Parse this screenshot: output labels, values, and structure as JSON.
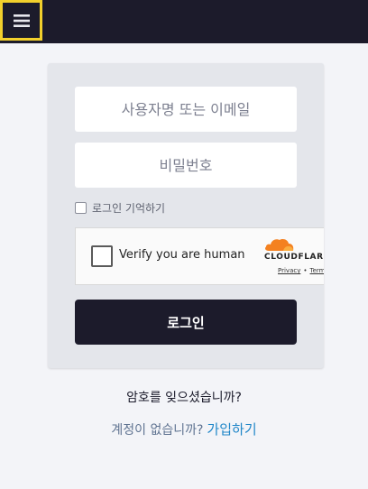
{
  "header": {
    "menu_icon": "hamburger-menu-icon",
    "background_color": "#1c1b2b",
    "focus_outline_color": "#f2d02c"
  },
  "login_form": {
    "username": {
      "placeholder": "사용자명 또는 이메일",
      "value": ""
    },
    "password": {
      "placeholder": "비밀번호",
      "value": ""
    },
    "remember_me": {
      "label": "로그인 기억하기",
      "checked": false
    },
    "captcha": {
      "label": "Verify you are human",
      "brand": "CLOUDFLARE",
      "privacy_link": "Privacy",
      "separator": "•",
      "terms_link": "Terms",
      "checked": false
    },
    "submit_label": "로그인",
    "submit_color": "#1c1b2b"
  },
  "footer": {
    "forgot_password": "암호를 잊으셨습니까?",
    "no_account": "계정이 없습니까?",
    "signup_link": "가입하기",
    "link_color": "#1f86c8"
  }
}
